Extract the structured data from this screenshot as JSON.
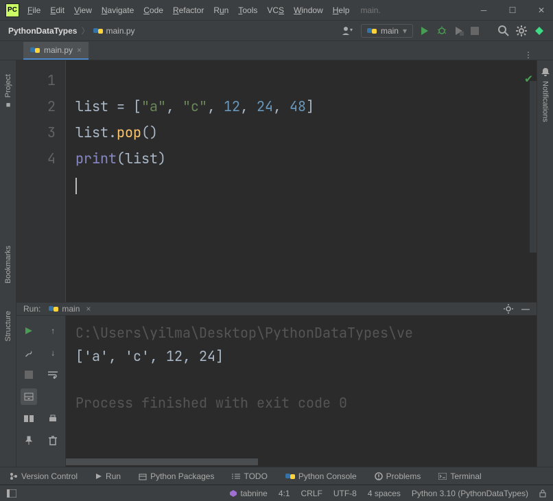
{
  "app_icon_text": "PC",
  "menubar": {
    "file": "File",
    "edit": "Edit",
    "view": "View",
    "navigate": "Navigate",
    "code": "Code",
    "refactor": "Refactor",
    "run": "Run",
    "tools": "Tools",
    "vcs": "VCS",
    "window": "Window",
    "help": "Help"
  },
  "title_filename": "main.",
  "breadcrumb": {
    "project": "PythonDataTypes",
    "file": "main.py"
  },
  "run_config_name": "main",
  "editor_tab": {
    "name": "main.py"
  },
  "line_numbers": [
    "1",
    "2",
    "3",
    "4"
  ],
  "code": {
    "l1": {
      "a": "list = [",
      "s1": "\"a\"",
      "c1": ", ",
      "s2": "\"c\"",
      "c2": ", ",
      "n1": "12",
      "c3": ", ",
      "n2": "24",
      "c4": ", ",
      "n3": "48",
      "z": "]"
    },
    "l2": {
      "a": "list.",
      "fn": "pop",
      "p": "()"
    },
    "l3": {
      "fn": "print",
      "p1": "(",
      "arg": "list",
      "p2": ")"
    }
  },
  "run_panel": {
    "label": "Run:",
    "tab_name": "main",
    "command_line": "C:\\Users\\yilma\\Desktop\\PythonDataTypes\\ve",
    "output": "['a', 'c', 12, 24]",
    "exit_line": "Process finished with exit code 0"
  },
  "left_strip": {
    "project": "Project",
    "bookmarks": "Bookmarks",
    "structure": "Structure"
  },
  "right_strip": {
    "notifications": "Notifications"
  },
  "bottom_tw": {
    "vcs": "Version Control",
    "run": "Run",
    "pkg": "Python Packages",
    "todo": "TODO",
    "console": "Python Console",
    "problems": "Problems",
    "terminal": "Terminal"
  },
  "status": {
    "tabnine": "tabnine",
    "pos": "4:1",
    "lineend": "CRLF",
    "encoding": "UTF-8",
    "indent": "4 spaces",
    "interpreter": "Python 3.10 (PythonDataTypes)"
  }
}
